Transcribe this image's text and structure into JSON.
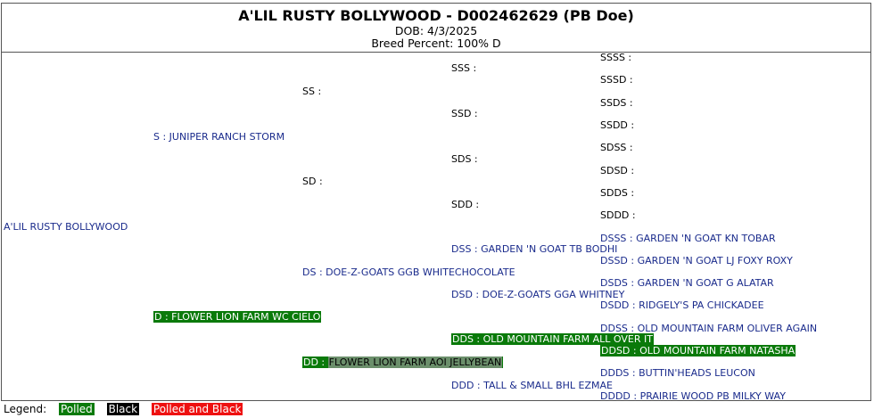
{
  "header": {
    "title": "A'LIL RUSTY BOLLYWOOD - D002462629 (PB Doe)",
    "dob": "DOB: 4/3/2025",
    "breed": "Breed Percent: 100% D"
  },
  "animal": "A'LIL RUSTY BOLLYWOOD",
  "gen1": {
    "s": "S : JUNIPER RANCH STORM",
    "d_code": "D : ",
    "d_name": "FLOWER LION FARM WC CIELO"
  },
  "gen2": {
    "ss": "SS :",
    "sd": "SD :",
    "ds": "DS : DOE-Z-GOATS GGB WHITECHOCOLATE",
    "dd_code": "DD : ",
    "dd_name": "FLOWER LION FARM AOI JELLYBEAN"
  },
  "gen3": {
    "sss": "SSS :",
    "ssd": "SSD :",
    "sds": "SDS :",
    "sdd": "SDD :",
    "dss": "DSS : GARDEN 'N GOAT TB BODHI",
    "dsd": "DSD : DOE-Z-GOATS GGA WHITNEY",
    "dds_code": "DDS : ",
    "dds_name": "OLD MOUNTAIN FARM ALL OVER IT",
    "ddd": "DDD : TALL & SMALL BHL EZMAE"
  },
  "gen4": {
    "ssss": "SSSS :",
    "sssd": "SSSD :",
    "ssds": "SSDS :",
    "ssdd": "SSDD :",
    "sdss": "SDSS :",
    "sdsd": "SDSD :",
    "sdds": "SDDS :",
    "sddd": "SDDD :",
    "dsss": "DSSS : GARDEN 'N GOAT KN TOBAR",
    "dssd": "DSSD : GARDEN 'N GOAT LJ FOXY ROXY",
    "dsds": "DSDS : GARDEN 'N GOAT G ALATAR",
    "dsdd": "DSDD : RIDGELY'S PA CHICKADEE",
    "ddss": "DDSS : OLD MOUNTAIN FARM OLIVER AGAIN",
    "ddsd_code": "DDSD : ",
    "ddsd_name": "OLD MOUNTAIN FARM NATASHA",
    "ddds": "DDDS : BUTTIN'HEADS LEUCON",
    "dddd": "DDDD : PRAIRIE WOOD PB MILKY WAY"
  },
  "legend": {
    "label": "Legend:",
    "polled": "Polled",
    "black": "Black",
    "polled_black": "Polled and Black"
  },
  "colors": {
    "link": "#1a2b8c",
    "polled": "#0a7a0a",
    "black": "#000000",
    "polled_and_black": "#ee1111"
  }
}
